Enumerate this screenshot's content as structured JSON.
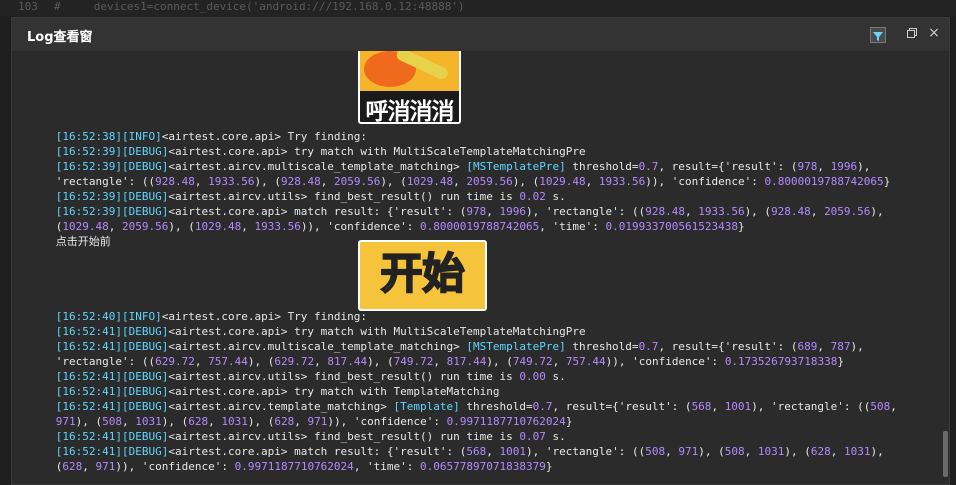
{
  "editor": {
    "line_no": "103",
    "code_line": "#     devices1=connect_device('android:///192.168.0.12:48888')"
  },
  "window": {
    "title": "Log查看窗"
  },
  "icons": {
    "filter": "filter-icon",
    "restore": "restore-icon",
    "close": "close-icon"
  },
  "images": {
    "img1_text": "呼消消消",
    "img2_text": "开始"
  },
  "log": {
    "l1": {
      "ts": "[16:52:38]",
      "tag": "[INFO]",
      "text": "<airtest.core.api> Try finding:"
    },
    "l2": {
      "ts": "[16:52:39]",
      "tag": "[DEBUG]",
      "text": "<airtest.core.api> try match with MultiScaleTemplateMatchingPre"
    },
    "l3": {
      "ts": "[16:52:39]",
      "tag": "[DEBUG]",
      "text": "<airtest.aircv.multiscale_template_matching> ",
      "t2": "[MSTemplatePre]",
      "t3": " threshold=",
      "n1": "0.7",
      "t4": ", result={'result': (",
      "n2": "978",
      "t5": ", ",
      "n3": "1996",
      "t6": "),"
    },
    "l4": {
      "t1": "'rectangle': ((",
      "n1": "928.48",
      "t2": ", ",
      "n2": "1933.56",
      "t3": "), (",
      "n3": "928.48",
      "t4": ", ",
      "n4": "2059.56",
      "t5": "), (",
      "n5": "1029.48",
      "t6": ", ",
      "n6": "2059.56",
      "t7": "), (",
      "n7": "1029.48",
      "t8": ", ",
      "n8": "1933.56",
      "t9": ")), 'confidence': ",
      "n9": "0.8000019788742065",
      "t10": "}"
    },
    "l5": {
      "ts": "[16:52:39]",
      "tag": "[DEBUG]",
      "text": "<airtest.aircv.utils> find_best_result() run time is ",
      "n1": "0.02",
      "t2": " s."
    },
    "l6": {
      "ts": "[16:52:39]",
      "tag": "[DEBUG]",
      "text": "<airtest.core.api> match result: {'result': (",
      "n1": "978",
      "t2": ", ",
      "n2": "1996",
      "t3": "), 'rectangle': ((",
      "n3": "928.48",
      "t4": ", ",
      "n4": "1933.56",
      "t5": "), (",
      "n5": "928.48",
      "t6": ", ",
      "n6": "2059.56",
      "t7": "),"
    },
    "l7": {
      "t0": "(",
      "n1": "1029.48",
      "t1": ", ",
      "n2": "2059.56",
      "t2": "), (",
      "n3": "1029.48",
      "t3": ", ",
      "n4": "1933.56",
      "t4": ")), 'confidence': ",
      "n5": "0.8000019788742065",
      "t5": ", 'time': ",
      "n6": "0.019933700561523438",
      "t6": "}"
    },
    "l8": {
      "text": "点击开始前"
    },
    "l9": {
      "ts": "[16:52:40]",
      "tag": "[INFO]",
      "text": "<airtest.core.api> Try finding:"
    },
    "l10": {
      "ts": "[16:52:41]",
      "tag": "[DEBUG]",
      "text": "<airtest.core.api> try match with MultiScaleTemplateMatchingPre"
    },
    "l11": {
      "ts": "[16:52:41]",
      "tag": "[DEBUG]",
      "text": "<airtest.aircv.multiscale_template_matching> ",
      "t2": "[MSTemplatePre]",
      "t3": " threshold=",
      "n1": "0.7",
      "t4": ", result={'result': (",
      "n2": "689",
      "t5": ", ",
      "n3": "787",
      "t6": "),"
    },
    "l12": {
      "t1": "'rectangle': ((",
      "n1": "629.72",
      "t2": ", ",
      "n2": "757.44",
      "t3": "), (",
      "n3": "629.72",
      "t4": ", ",
      "n4": "817.44",
      "t5": "), (",
      "n5": "749.72",
      "t6": ", ",
      "n6": "817.44",
      "t7": "), (",
      "n7": "749.72",
      "t8": ", ",
      "n8": "757.44",
      "t9": ")), 'confidence': ",
      "n9": "0.173526793718338",
      "t10": "}"
    },
    "l13": {
      "ts": "[16:52:41]",
      "tag": "[DEBUG]",
      "text": "<airtest.aircv.utils> find_best_result() run time is ",
      "n1": "0.00",
      "t2": " s."
    },
    "l14": {
      "ts": "[16:52:41]",
      "tag": "[DEBUG]",
      "text": "<airtest.core.api> try match with TemplateMatching"
    },
    "l15": {
      "ts": "[16:52:41]",
      "tag": "[DEBUG]",
      "text": "<airtest.aircv.template_matching> ",
      "t2": "[Template]",
      "t3": " threshold=",
      "n1": "0.7",
      "t4": ", result={'result': (",
      "n2": "568",
      "t5": ", ",
      "n3": "1001",
      "t6": "), 'rectangle': ((",
      "n4": "508",
      "t7": ","
    },
    "l16": {
      "n1": "971",
      "t1": "), (",
      "n2": "508",
      "t2": ", ",
      "n3": "1031",
      "t3": "), (",
      "n4": "628",
      "t4": ", ",
      "n5": "1031",
      "t5": "), (",
      "n6": "628",
      "t6": ", ",
      "n7": "971",
      "t7": ")), 'confidence': ",
      "n8": "0.9971187710762024",
      "t8": "}"
    },
    "l17": {
      "ts": "[16:52:41]",
      "tag": "[DEBUG]",
      "text": "<airtest.aircv.utils> find_best_result() run time is ",
      "n1": "0.07",
      "t2": " s."
    },
    "l18": {
      "ts": "[16:52:41]",
      "tag": "[DEBUG]",
      "text": "<airtest.core.api> match result: {'result': (",
      "n1": "568",
      "t2": ", ",
      "n2": "1001",
      "t3": "), 'rectangle': ((",
      "n3": "508",
      "t4": ", ",
      "n4": "971",
      "t5": "), (",
      "n5": "508",
      "t6": ", ",
      "n6": "1031",
      "t7": "), (",
      "n7": "628",
      "t8": ", ",
      "n8": "1031",
      "t9": "),"
    },
    "l19": {
      "t0": "(",
      "n1": "628",
      "t1": ", ",
      "n2": "971",
      "t2": ")), 'confidence': ",
      "n3": "0.9971187710762024",
      "t3": ", 'time': ",
      "n4": "0.06577897071838379",
      "t4": "}"
    }
  }
}
